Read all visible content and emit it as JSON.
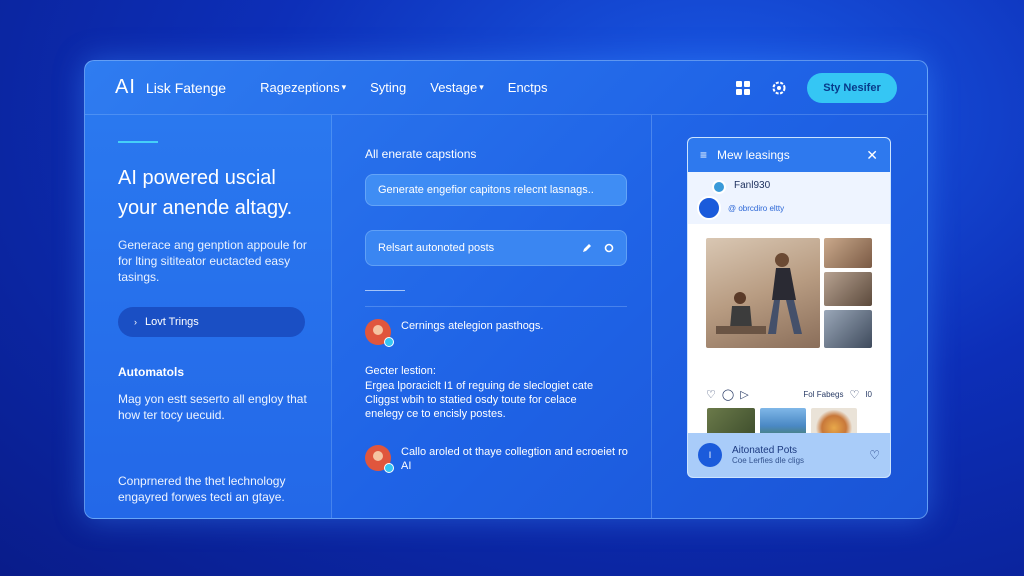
{
  "app": {
    "logo": "AI",
    "name": "Lisk Fatenge"
  },
  "nav": {
    "items": [
      {
        "label": "Ragezeptions",
        "has_caret": true
      },
      {
        "label": "Syting",
        "has_caret": false
      },
      {
        "label": "Vestage",
        "has_caret": true
      },
      {
        "label": "Enctps",
        "has_caret": false
      }
    ],
    "caret": "▾",
    "cta_label": "Sty Nesifer"
  },
  "left": {
    "hero": "AI powered uscial your anende altagy.",
    "hero_sub": "Generace ang genption appoule for for lting sititeator euctacted easy tasings.",
    "button_label": "Lovt Trings",
    "button_chevron": "›",
    "section_title": "Automatols",
    "section_text": "Mag yon estt seserto all engloy that how ter tocy uecuid.",
    "bottom_text": "Conprnered the thet lechnology engayred forwes tecti an gtaye."
  },
  "middle": {
    "label": "All enerate capstions",
    "generate_field": "Generate engefior capitons relecnt lasnags..",
    "repost_field": "Relsart autonoted posts",
    "caption_1": "Cernings atelegion pasthogs.",
    "block_title": "Gecter lestion:",
    "block_text": "Ergea lporaciclt I1 of reguing de sleclogiet cate Cliggst wbih to statied osdy toute for celace enelegy ce to encisly postes.",
    "caption_2": "Callo aroled ot thaye collegtion and ecroeiet ro AI"
  },
  "panel": {
    "title": "Mew leasings",
    "menu_icon": "≡",
    "close_icon": "✕",
    "user_name": "Fanl930",
    "user_handle": "@ obrcdiro eltty",
    "like_count": "Fol Fabegs",
    "count_right": "I0",
    "footer_title": "Aitonated Pots",
    "footer_sub": "Coe Lerfies dle cligs",
    "avatar_letter": "I"
  },
  "colors": {
    "accent": "#35c6f4",
    "window": "#2368e8",
    "background": "#0d2fb8"
  },
  "icons": [
    "grid-icon",
    "settings-icon",
    "menu-icon",
    "close-icon",
    "heart-icon",
    "comment-icon",
    "pencil-icon",
    "circle-icon"
  ]
}
